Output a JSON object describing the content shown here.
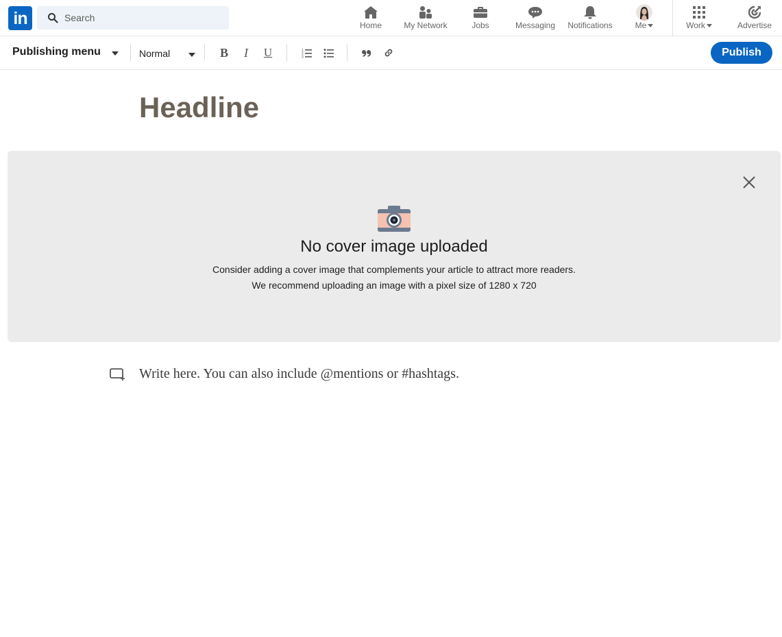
{
  "nav": {
    "logo_text": "in",
    "search_placeholder": "Search",
    "items": [
      {
        "label": "Home",
        "icon": "home-icon"
      },
      {
        "label": "My Network",
        "icon": "people-icon"
      },
      {
        "label": "Jobs",
        "icon": "briefcase-icon"
      },
      {
        "label": "Messaging",
        "icon": "chat-icon"
      },
      {
        "label": "Notifications",
        "icon": "bell-icon"
      },
      {
        "label": "Me",
        "icon": "avatar"
      },
      {
        "label": "Work",
        "icon": "grid-icon"
      },
      {
        "label": "Advertise",
        "icon": "target-icon"
      }
    ]
  },
  "toolbar": {
    "publishing_menu": "Publishing menu",
    "text_style": "Normal",
    "bold": "B",
    "italic": "I",
    "underline": "U",
    "publish_label": "Publish"
  },
  "editor": {
    "headline_placeholder": "Headline",
    "body_placeholder": "Write here. You can also include @mentions or #hashtags."
  },
  "cover": {
    "title": "No cover image uploaded",
    "line1": "Consider adding a cover image that complements your article to attract more readers.",
    "line2": "We recommend uploading an image with a pixel size of 1280 x 720"
  },
  "colors": {
    "brand": "#0a66c2",
    "cover_bg": "#ebebeb",
    "headline": "#6b6257"
  }
}
